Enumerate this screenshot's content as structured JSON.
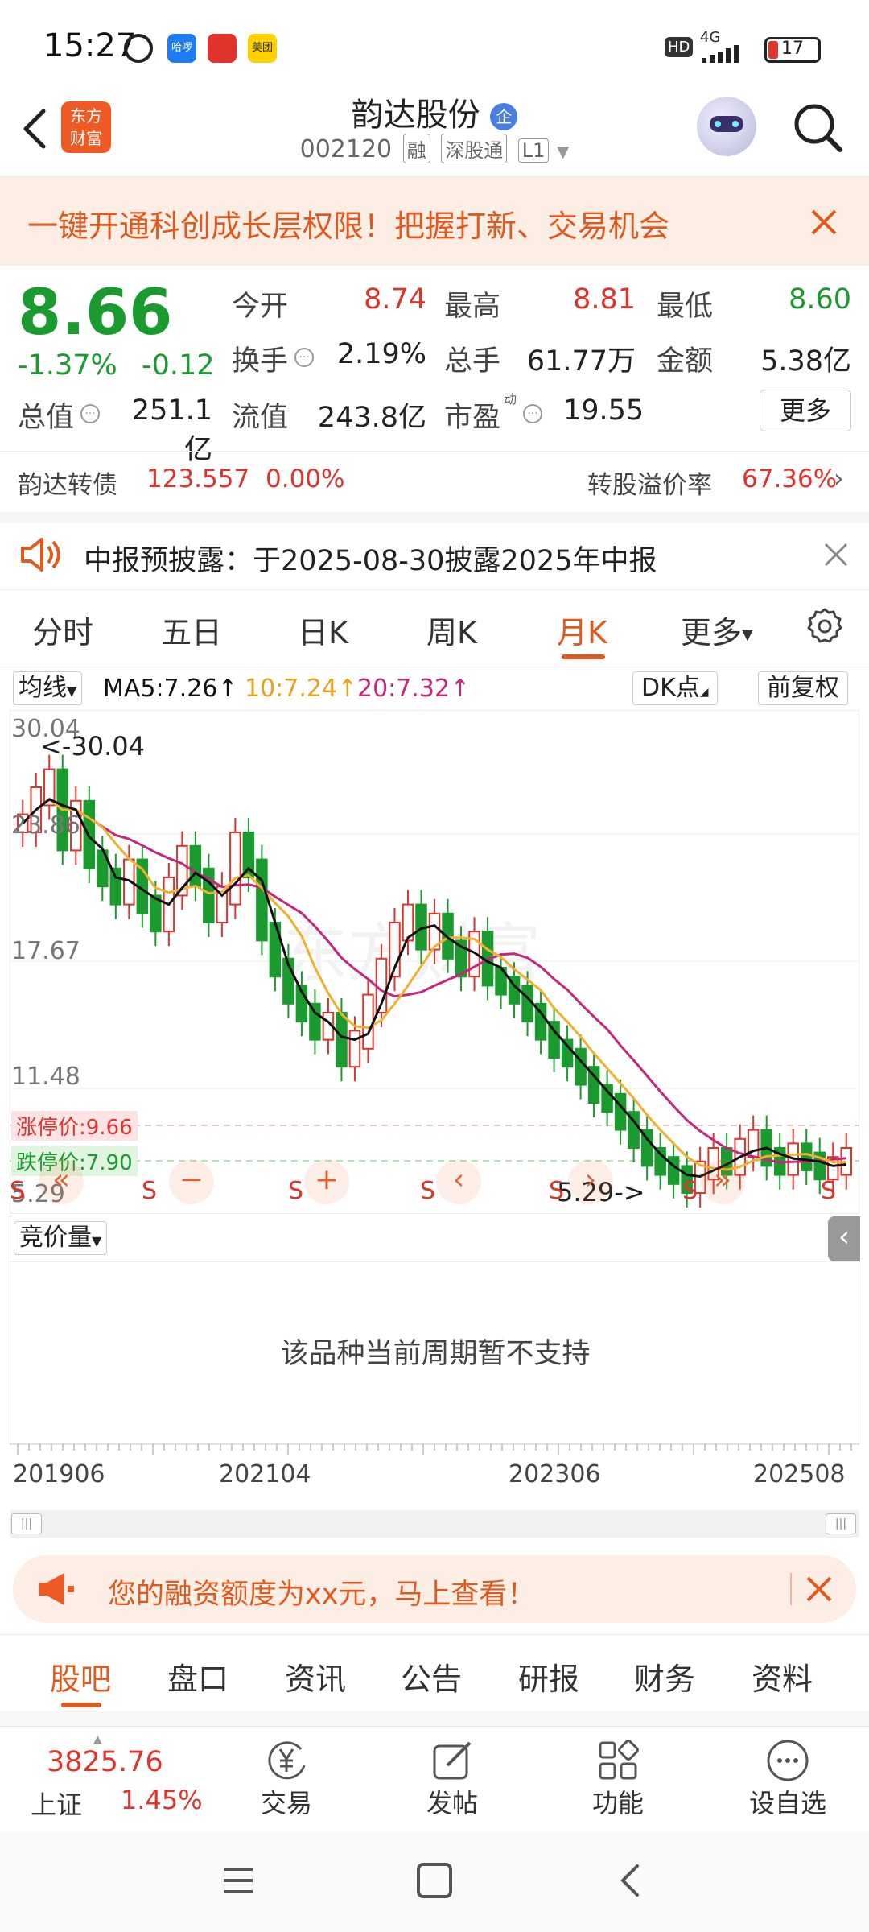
{
  "status_bar": {
    "time": "15:27",
    "apps": [
      "哈啰",
      "",
      "美团"
    ],
    "hd": "HD",
    "network": "4G",
    "battery": "17"
  },
  "header": {
    "stock_name": "韵达股份",
    "badge": "企",
    "code": "002120",
    "tags": [
      "融",
      "深股通",
      "L1"
    ],
    "logo_line1": "东方",
    "logo_line2": "财富"
  },
  "promo": {
    "text": "一键开通科创成长层权限！把握打新、交易机会"
  },
  "quote": {
    "price": "8.66",
    "change_pct": "-1.37%",
    "change": "-0.12",
    "open_label": "今开",
    "open": "8.74",
    "high_label": "最高",
    "high": "8.81",
    "low_label": "最低",
    "low": "8.60",
    "turnover_label": "换手",
    "turnover": "2.19%",
    "volume_label": "总手",
    "volume": "61.77万",
    "amount_label": "金额",
    "amount": "5.38亿",
    "mktcap_label": "总值",
    "mktcap": "251.1亿",
    "float_label": "流值",
    "float": "243.8亿",
    "pe_label": "市盈",
    "pe_sup": "动",
    "pe": "19.55",
    "more": "更多"
  },
  "convertible": {
    "name": "韵达转债",
    "price": "123.557",
    "pct": "0.00%",
    "premium_label": "转股溢价率",
    "premium": "67.36%"
  },
  "notice": {
    "text": "中报预披露：于2025-08-30披露2025年中报"
  },
  "kline_tabs": [
    "分时",
    "五日",
    "日K",
    "周K",
    "月K",
    "更多"
  ],
  "active_tab": "月K",
  "chart_controls": {
    "ma_selector": "均线",
    "ma5": "MA5:7.26↑",
    "ma10": "10:7.24↑",
    "ma20": "20:7.32↑",
    "dk": "DK点",
    "fq": "前复权"
  },
  "chart_data": {
    "type": "candlestick",
    "ylabels": [
      "30.04",
      "23.86",
      "17.67",
      "11.48",
      "5.29"
    ],
    "max_marker": "<-30.04",
    "min_marker": "5.29->",
    "limit_up": "涨停价:9.66",
    "limit_down": "跌停价:7.90",
    "xlabels": [
      "201906",
      "202104",
      "202306",
      "202508"
    ],
    "ma_colors": {
      "ma5": "#111111",
      "ma10": "#f0b030",
      "ma20": "#c8267a"
    }
  },
  "volume_panel": {
    "selector": "竞价量",
    "message": "该品种当前周期暂不支持"
  },
  "financing_banner": {
    "text": "您的融资额度为xx元，马上查看！"
  },
  "bottom_tabs": [
    "股吧",
    "盘口",
    "资讯",
    "公告",
    "研报",
    "财务",
    "资料"
  ],
  "index_info": {
    "value": "3825.76",
    "name": "上证",
    "pct": "1.45%"
  },
  "nav": {
    "trade": "交易",
    "post": "发帖",
    "func": "功能",
    "watch": "设自选"
  }
}
